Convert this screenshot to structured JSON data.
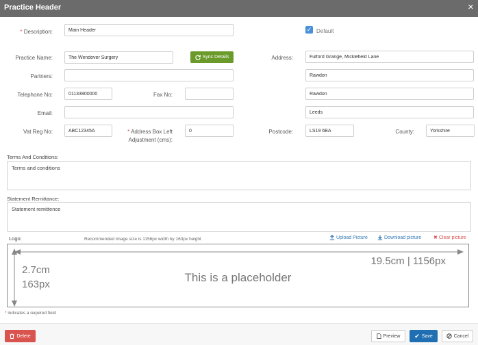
{
  "window": {
    "title": "Practice Header",
    "close_symbol": "✕"
  },
  "form": {
    "description": {
      "label": "Description:",
      "value": "Main Header"
    },
    "default": {
      "label": "Default",
      "checked": true
    },
    "practice_name": {
      "label": "Practice Name:",
      "value": "The Wendover Surgery"
    },
    "sync_label": "Sync Details",
    "partners": {
      "label": "Partners:",
      "value": ""
    },
    "telephone": {
      "label": "Telephone No:",
      "value": "01133800000"
    },
    "fax": {
      "label": "Fax No:",
      "value": ""
    },
    "email": {
      "label": "Email:",
      "value": ""
    },
    "vat": {
      "label": "Vat Reg No:",
      "value": "ABC12345A"
    },
    "address_adjust": {
      "label_line1": "Address Box Left",
      "label_line2": "Adjustment (cms):",
      "value": "0"
    },
    "address": {
      "label": "Address:",
      "line1": "Fulford Grange, Micklefield Lane",
      "line2": "Rawdon",
      "line3": "Rawdon",
      "line4": "Leeds"
    },
    "postcode": {
      "label": "Postcode:",
      "value": "LS19 6BA"
    },
    "county": {
      "label": "County:",
      "value": "Yorkshire"
    },
    "terms": {
      "label": "Terms And Conditions:",
      "value": "Terms and conditions"
    },
    "statement": {
      "label": "Statement Remittance:",
      "value": "Statement remittence"
    }
  },
  "logo": {
    "label": "Logo:",
    "hint": "Recommended image size is 1156px width by 163px height",
    "upload": "Upload Picture",
    "download": "Download picture",
    "clear": "Clear picture",
    "placeholder": "This is a placeholder",
    "height_cm": "2.7cm",
    "height_px": "163px",
    "width_text": "19.5cm | 1156px"
  },
  "required_note": "indicates a required field",
  "footer": {
    "delete": "Delete",
    "preview": "Preview",
    "save": "Save",
    "cancel": "Cancel"
  },
  "colors": {
    "titlebar": "#6b6b6b",
    "sync": "#6a9a2a",
    "delete": "#d9534f",
    "save": "#1f6fb2",
    "link": "#337ab7",
    "required": "#d9534f"
  }
}
